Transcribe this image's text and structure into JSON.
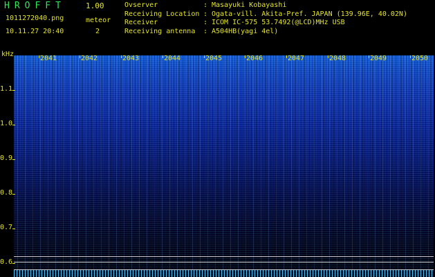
{
  "header": {
    "app_title": "HROFFT",
    "version": "1.00",
    "filename": "1011272040.png",
    "mode": "meteor",
    "datetime": "10.11.27 20:40",
    "count": "2"
  },
  "info": [
    {
      "label": "Ovserver",
      "sep": ":",
      "value": "Masayuki Kobayashi"
    },
    {
      "label": "Receiving Location",
      "sep": ":",
      "value": "Ogata-vill. Akita-Pref. JAPAN (139.96E, 40.02N)"
    },
    {
      "label": "Receiver",
      "sep": ":",
      "value": "ICOM IC-575 53.7492(@LCD)MHz USB"
    },
    {
      "label": "Receiving antenna",
      "sep": ":",
      "value": "A504HB(yagi 4el)"
    }
  ],
  "axis": {
    "freq_unit": "kHz",
    "freq_ticks": [
      "1.1",
      "1.0",
      "0.9",
      "0.8",
      "0.7",
      "0.6"
    ],
    "time_ticks": [
      "2041",
      "2042",
      "2043",
      "2044",
      "2045",
      "2046",
      "2047",
      "2048",
      "2049",
      "2050"
    ]
  },
  "colors": {
    "text_yellow": "#e6e622",
    "title_green": "#2ee65a",
    "spectrum_blue": "#1a4fc6",
    "background": "#000000"
  }
}
